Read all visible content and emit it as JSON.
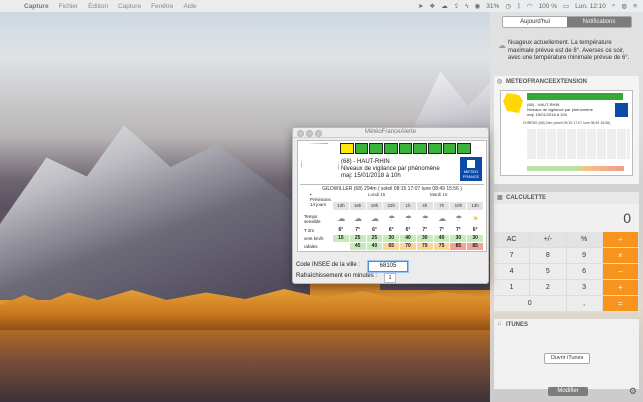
{
  "menubar": {
    "items": [
      "Capture",
      "Fichier",
      "Édition",
      "Capture",
      "Fenêtre",
      "Aide"
    ],
    "battery_percent": "31%",
    "battery_label": "100 %",
    "clock": "Lun. 12:10"
  },
  "notification_center": {
    "tabs": [
      "Aujourd'hui",
      "Notifications"
    ],
    "weather_text": "Nuageux actuellement. La température maximale prévue est de 8°. Averses ce soir, avec une température minimale prévue de 6°.",
    "sections": {
      "meteo": "METEOFRANCEEXTENSION",
      "calc": "CALCULETTE",
      "itunes": "ITUNES"
    },
    "meteo_mini": {
      "dept": "(68) - HAUT-RHIN",
      "line1": "Niveaux de vigilance par phénomène",
      "line2": "maj: 15/01/2018 à 10h",
      "loc": "CHRENS (68) 24m (soleil 08:15 17:07 lune 08:49 15:56)"
    },
    "calculator": {
      "display": "0",
      "keys": [
        "AC",
        "+/-",
        "%",
        "÷",
        "7",
        "8",
        "9",
        "×",
        "4",
        "5",
        "6",
        "−",
        "1",
        "2",
        "3",
        "+",
        "0",
        ",",
        "="
      ]
    },
    "itunes_button": "Ouvrir iTunes",
    "modifier_button": "Modifier"
  },
  "window": {
    "title": "MétéoFranceAlerte",
    "dept": "(68) - HAUT-RHIN",
    "vigilance": "Niveaux de vigilance par phénomène",
    "maj": "maj: 15/01/2018 à 10h",
    "logo_text": "METEO FRANCE",
    "location": "GILDWILLER (68) 294m ( soleil 08:15 17:07 lune 08:49 15:56 )",
    "prev_label": "• Prévisions 14 jours",
    "day1": "Lundi 15",
    "day2": "Mardi 16",
    "hours": [
      "13h",
      "16h",
      "19h",
      "22h",
      "1h",
      "4h",
      "7h",
      "10h",
      "13h"
    ],
    "row_labels": {
      "sky": "Temps sensible",
      "temp": "T 2m",
      "wind": "vent km/h",
      "gusts": "rafales"
    },
    "temps": [
      "6°",
      "7°",
      "6°",
      "6°",
      "6°",
      "7°",
      "7°",
      "7°",
      "6°"
    ],
    "wind": [
      "15",
      "25",
      "25",
      "30",
      "40",
      "30",
      "40",
      "30",
      "30"
    ],
    "gusts": [
      "45",
      "40",
      "65",
      "70",
      "70",
      "75",
      "85",
      "85"
    ],
    "code_label": "Code INSEE de la ville :",
    "code_value": "68105",
    "refresh_label": "Rafraîchissement en minutes :",
    "refresh_value": "1"
  },
  "colors": {
    "calc_orange": "#f7941d",
    "vig_green": "#3cb43c",
    "vig_yellow": "#ffe800",
    "meteo_blue": "#0b4ba8"
  }
}
